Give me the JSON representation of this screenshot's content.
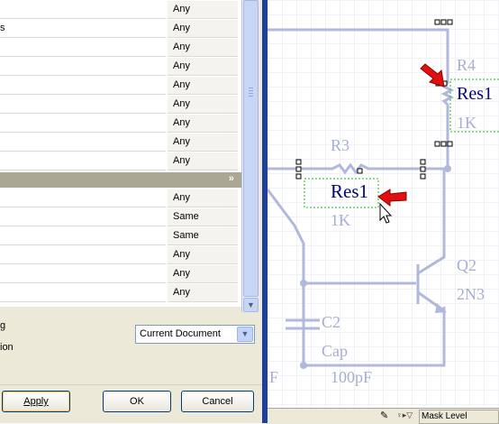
{
  "grid": {
    "rows_top": [
      {
        "label": "",
        "value": "Any"
      },
      {
        "label": "s",
        "value": "Any"
      },
      {
        "label": "",
        "value": "Any"
      },
      {
        "label": "",
        "value": "Any"
      },
      {
        "label": "",
        "value": "Any"
      },
      {
        "label": "",
        "value": "Any"
      },
      {
        "label": "",
        "value": "Any"
      },
      {
        "label": "",
        "value": "Any"
      },
      {
        "label": "",
        "value": "Any"
      }
    ],
    "group_chevron": "»",
    "rows_bottom": [
      {
        "label": "",
        "value": "Any"
      },
      {
        "label": "",
        "value": "Same"
      },
      {
        "label": "",
        "value": "Same"
      },
      {
        "label": "",
        "value": "Any"
      },
      {
        "label": "",
        "value": "Any"
      },
      {
        "label": "",
        "value": "Any"
      }
    ]
  },
  "options": {
    "label1": "g",
    "label2": "ion",
    "scope_value": "Current Document"
  },
  "buttons": {
    "apply": "Apply",
    "ok": "OK",
    "cancel": "Cancel"
  },
  "schematic": {
    "r4_designator": "R4",
    "r4_comment": "Res1",
    "r4_value": "1K",
    "r3_designator": "R3",
    "r3_comment": "Res1",
    "r3_value": "1K",
    "q2_designator": "Q2",
    "q2_comment": "2N3",
    "c2_designator": "C2",
    "c2_comment": "Cap",
    "c2_value": "100pF",
    "edge_label": "F"
  },
  "status": {
    "mask_label": "Mask Level"
  },
  "colors": {
    "wire": "#b0b8dc",
    "text_faded": "#a6aed4",
    "text_selected": "#000080",
    "arrow": "#e01010"
  }
}
